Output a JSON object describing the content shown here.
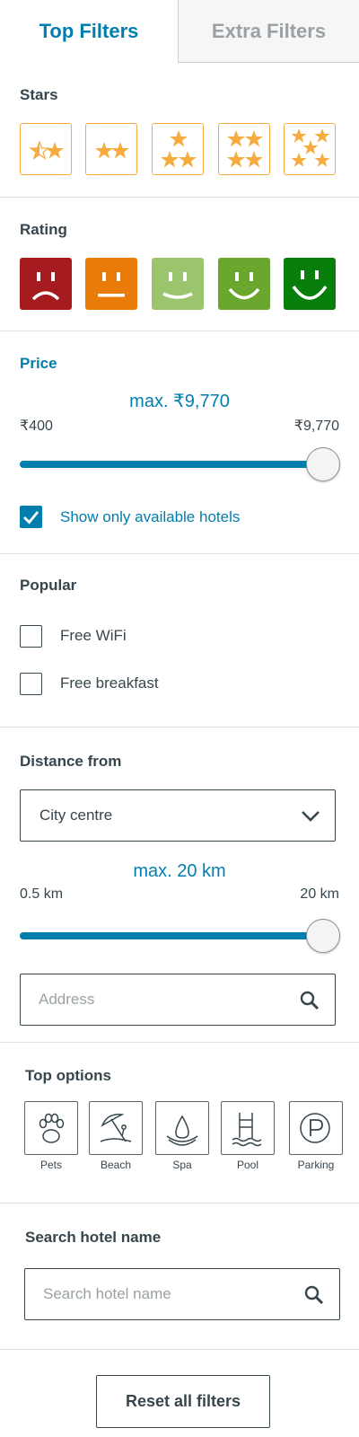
{
  "tabs": {
    "active": "Top Filters",
    "inactive": "Extra Filters"
  },
  "stars": {
    "label": "Stars",
    "options": [
      {
        "icon": "one-star-icon"
      },
      {
        "icon": "two-stars-icon"
      },
      {
        "icon": "three-stars-icon"
      },
      {
        "icon": "four-stars-icon"
      },
      {
        "icon": "five-stars-icon"
      }
    ],
    "color": "#f6ab3f"
  },
  "rating": {
    "label": "Rating",
    "options": [
      {
        "icon": "very-sad-face-icon",
        "color": "#a51b1e"
      },
      {
        "icon": "neutral-face-icon",
        "color": "#e97c08"
      },
      {
        "icon": "slight-smile-face-icon",
        "color": "#9ac56d"
      },
      {
        "icon": "smile-face-icon",
        "color": "#6ba72e"
      },
      {
        "icon": "big-smile-face-icon",
        "color": "#087e0b"
      }
    ]
  },
  "price": {
    "label": "Price",
    "max_label": "max. ₹9,770",
    "min_value": "₹400",
    "max_value": "₹9,770",
    "slider_fraction": 1.0,
    "available_checkbox": {
      "label": "Show only available hotels",
      "checked": true
    }
  },
  "popular": {
    "label": "Popular",
    "options": [
      {
        "label": "Free WiFi",
        "checked": false
      },
      {
        "label": "Free breakfast",
        "checked": false
      }
    ]
  },
  "distance": {
    "label": "Distance from",
    "selected": "City centre",
    "max_label": "max. 20 km",
    "min_value": "0.5 km",
    "max_value": "20 km",
    "slider_fraction": 1.0,
    "address_placeholder": "Address"
  },
  "top_options": {
    "label": "Top options",
    "items": [
      {
        "label": "Pets",
        "icon": "paw-icon"
      },
      {
        "label": "Beach",
        "icon": "beach-umbrella-icon"
      },
      {
        "label": "Spa",
        "icon": "spa-icon"
      },
      {
        "label": "Pool",
        "icon": "pool-ladder-icon"
      },
      {
        "label": "Parking",
        "icon": "parking-icon"
      }
    ]
  },
  "hotel_search": {
    "label": "Search hotel name",
    "placeholder": "Search hotel name"
  },
  "reset_label": "Reset all filters",
  "colors": {
    "accent": "#007faf",
    "text": "#37454d",
    "muted": "#9aa1a5"
  }
}
